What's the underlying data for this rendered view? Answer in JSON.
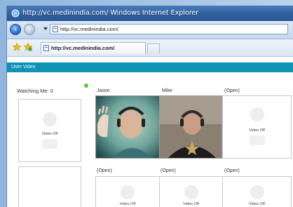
{
  "browser": {
    "window_title": "http://vc.medinindia.com/   Windows Internet Explorer",
    "address": "http://vc.medinindia.com/",
    "tab_title": "http://vc.medinindia.com/"
  },
  "app": {
    "section_title": "User Video",
    "watching_label": "Watching Me:  0",
    "video_off_text": "Video Off"
  },
  "slots": [
    {
      "label": "Jason",
      "state": "live video"
    },
    {
      "label": "Mike",
      "state": "live video"
    },
    {
      "label": "(Open)",
      "state": "Video Off"
    },
    {
      "label": "(Open)",
      "state": "Video Off"
    },
    {
      "label": "(Open)",
      "state": "Video Off"
    },
    {
      "label": "(Open)",
      "state": "Video Off"
    }
  ],
  "colors": {
    "section_bar": "#0d93b4",
    "status_dot": "#5fc544",
    "titlebar": "#2f5f9f"
  },
  "icons": [
    "ie-logo-icon",
    "back-arrow-icon",
    "forward-arrow-icon",
    "page-icon",
    "favorites-star-icon",
    "add-favorites-icon",
    "tab-page-icon",
    "user-placeholder-icon"
  ]
}
